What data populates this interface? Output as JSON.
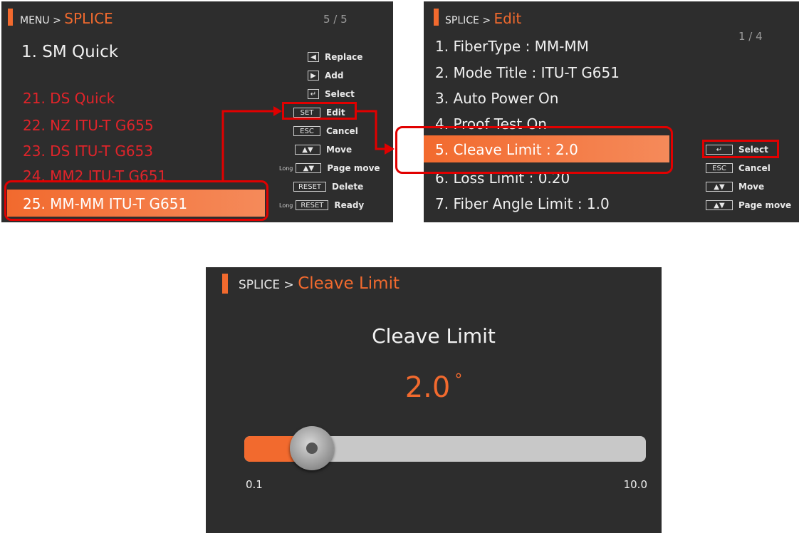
{
  "panel1": {
    "breadcrumb_parent": "MENU >",
    "breadcrumb_current": "SPLICE",
    "page": "5 / 5",
    "items": [
      {
        "label": "1. SM Quick"
      },
      {
        "label": "21. DS Quick"
      },
      {
        "label": "22. NZ ITU-T G655"
      },
      {
        "label": "23. DS ITU-T G653"
      },
      {
        "label": "24. MM2 ITU-T G651"
      },
      {
        "label": "25. MM-MM ITU-T G651"
      }
    ],
    "keys": [
      {
        "icon": "◀",
        "label": "Replace"
      },
      {
        "icon": "▶",
        "label": "Add"
      },
      {
        "icon": "↵",
        "label": "Select"
      },
      {
        "key": "SET",
        "label": "Edit"
      },
      {
        "key": "ESC",
        "label": "Cancel"
      },
      {
        "icon": "▲▼",
        "label": "Move"
      },
      {
        "prefix": "Long",
        "icon": "▲▼",
        "label": "Page move"
      },
      {
        "key": "RESET",
        "label": "Delete"
      },
      {
        "prefix": "Long",
        "key": "RESET",
        "label": "Ready"
      }
    ]
  },
  "panel2": {
    "breadcrumb_parent": "SPLICE >",
    "breadcrumb_current": "Edit",
    "page": "1 / 4",
    "items": [
      {
        "label": "1. FiberType : MM-MM"
      },
      {
        "label": "2. Mode Title : ITU-T G651"
      },
      {
        "label": "3. Auto Power   On"
      },
      {
        "label": "4. Proof Test   On"
      },
      {
        "label": "5. Cleave Limit : 2.0"
      },
      {
        "label": "6. Loss Limit : 0.20"
      },
      {
        "label": "7. Fiber Angle Limit : 1.0"
      }
    ],
    "keys": [
      {
        "icon": "↵",
        "label": "Select"
      },
      {
        "key": "ESC",
        "label": "Cancel"
      },
      {
        "icon": "▲▼",
        "label": "Move"
      },
      {
        "icon": "▲▼",
        "label": "Page move"
      }
    ]
  },
  "panel3": {
    "breadcrumb_parent": "SPLICE >",
    "breadcrumb_current": "Cleave Limit",
    "title": "Cleave Limit",
    "value": "2.0",
    "unit": "°",
    "slider_min": "0.1",
    "slider_max": "10.0",
    "slider_min_value": 0.1,
    "slider_max_value": 10.0,
    "slider_current": 2.0
  },
  "colors": {
    "accent": "#f26a2e",
    "panel_bg": "#2d2d2d",
    "annotation_red": "#e10000",
    "slider_track": "#c8c8c8"
  }
}
